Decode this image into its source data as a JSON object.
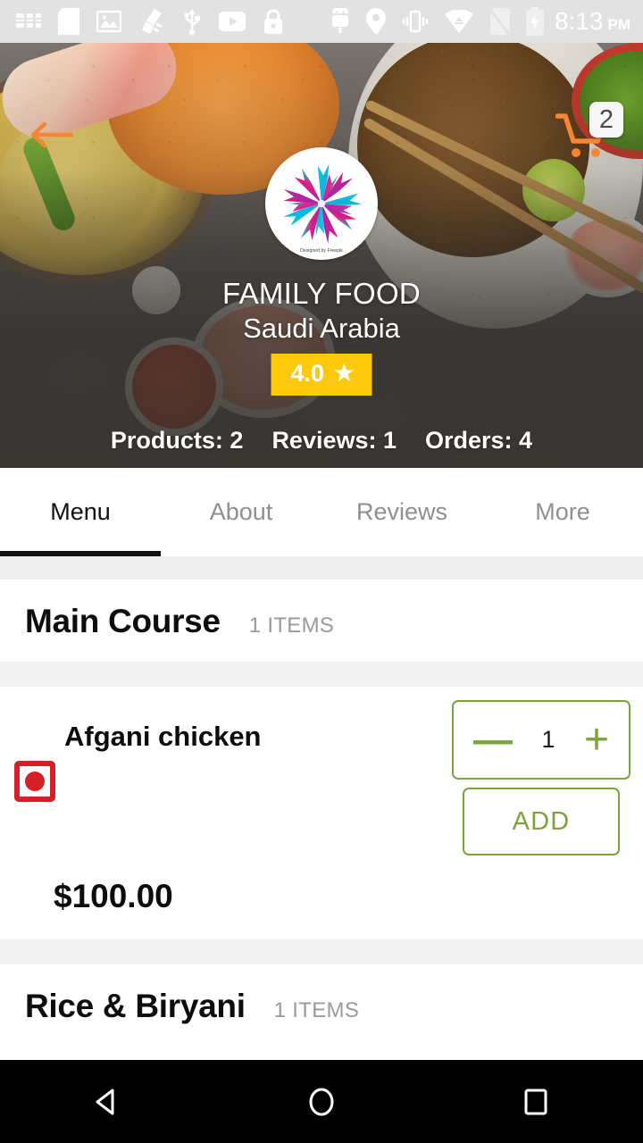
{
  "statusbar": {
    "icons_left": [
      "sim-card-icon",
      "sd-card-icon",
      "screenshot-icon",
      "cleaner-icon",
      "usb-icon",
      "youtube-icon",
      "lock-icon"
    ],
    "icons_right": [
      "android-icon",
      "location-icon",
      "vibrate-icon",
      "wifi-icon",
      "sim-off-icon",
      "battery-charging-icon"
    ],
    "time": "8:13",
    "ampm": "PM"
  },
  "header": {
    "back_icon": "back-arrow-icon",
    "cart_icon": "shopping-cart-icon",
    "cart_count": "2",
    "logo_credit": "Designed by Freepik",
    "restaurant_name": "FAMILY FOOD",
    "location": "Saudi Arabia",
    "rating": "4.0",
    "rating_star": "★",
    "stats": [
      {
        "label": "Products: 2"
      },
      {
        "label": "Reviews: 1"
      },
      {
        "label": "Orders: 4"
      }
    ]
  },
  "tabs": [
    {
      "label": "Menu",
      "active": true
    },
    {
      "label": "About",
      "active": false
    },
    {
      "label": "Reviews",
      "active": false
    },
    {
      "label": "More",
      "active": false
    }
  ],
  "sections": [
    {
      "title": "Main Course",
      "count": "1 ITEMS",
      "items": [
        {
          "name": "Afgani chicken",
          "diet_mark": "non-veg-indicator",
          "quantity": "1",
          "minus_label": "—",
          "plus_label": "+",
          "add_label": "ADD",
          "price": "$100.00"
        }
      ]
    },
    {
      "title": "Rice & Biryani",
      "count": "1 ITEMS",
      "items": []
    }
  ],
  "navbar": {
    "back": "nav-back-icon",
    "home": "nav-home-icon",
    "recents": "nav-recents-icon"
  },
  "colors": {
    "accent_orange": "#F58634",
    "rating_yellow": "#FCC90D",
    "action_green": "#7DA33A",
    "nonveg_red": "#D62027",
    "tab_active": "#111111"
  }
}
